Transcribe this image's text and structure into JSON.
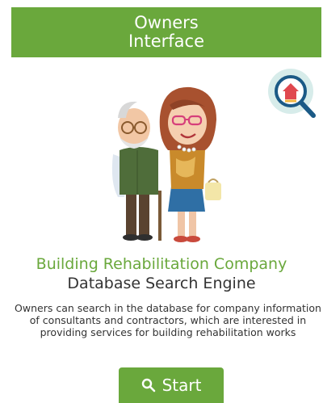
{
  "header": {
    "title_line1": "Owners",
    "title_line2": "Interface"
  },
  "hero": {
    "illustration_icon": "elderly-couple-illustration",
    "badge_icon": "house-search-icon"
  },
  "main": {
    "subtitle_green": "Building Rehabilitation Company",
    "subtitle_dark": "Database Search Engine",
    "description": "Owners can search in the database for company information of consultants and contractors, which are interested in providing services for building rehabilitation works"
  },
  "actions": {
    "start_label": "Start",
    "start_icon": "search-icon"
  },
  "colors": {
    "brand_green": "#6aa83c",
    "text_dark": "#333333",
    "badge_bg": "#d7ecea",
    "badge_house": "#e0484f",
    "magnifier": "#1b5a86"
  }
}
